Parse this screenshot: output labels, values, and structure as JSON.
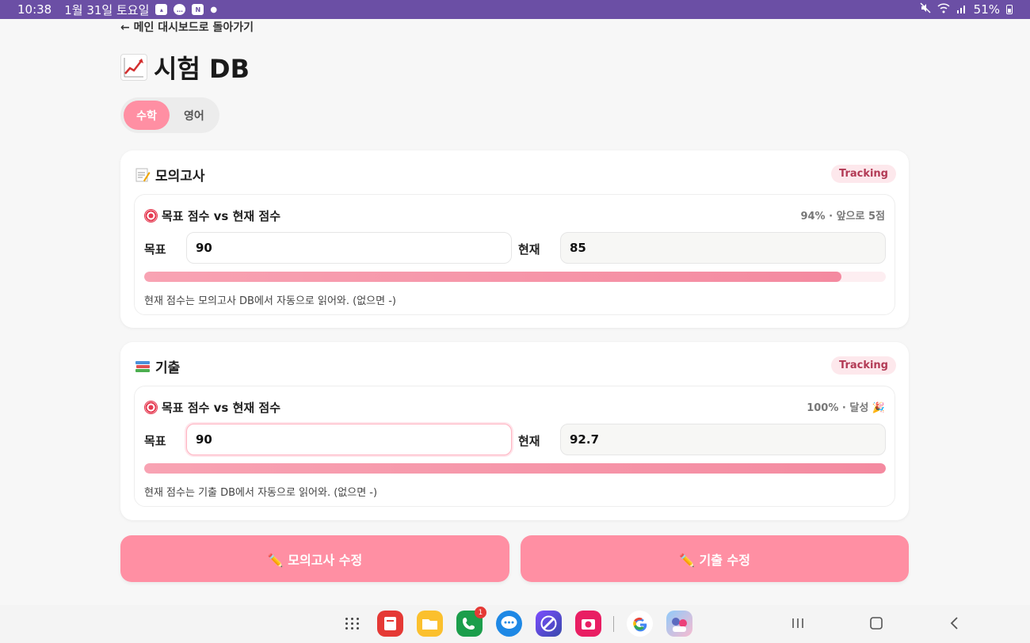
{
  "status": {
    "time": "10:38",
    "date": "1월 31일 토요일",
    "battery": "51%",
    "notif_icons": [
      "gallery-icon",
      "talk-icon",
      "naver-icon"
    ]
  },
  "nav": {
    "back_label": "← 메인 대시보드로 돌아가기"
  },
  "page": {
    "title": "시험 DB",
    "title_icon": "chart-increasing-icon"
  },
  "tabs": [
    {
      "label": "수학",
      "active": true
    },
    {
      "label": "영어",
      "active": false
    }
  ],
  "cards": [
    {
      "title": "모의고사",
      "icon": "memo-icon",
      "badge": "Tracking",
      "section_title": "목표 점수 vs 현재 점수",
      "progress_text": "94% · 앞으로 5점",
      "target_label": "목표",
      "target_value": "90",
      "current_label": "현재",
      "current_value": "85",
      "progress": 0.94,
      "note": "현재 점수는 모의고사 DB에서 자동으로 읽어와. (없으면 -)"
    },
    {
      "title": "기출",
      "icon": "books-icon",
      "badge": "Tracking",
      "section_title": "목표 점수 vs 현재 점수",
      "progress_text": "100% · 달성 🎉",
      "target_label": "목표",
      "target_value": "90",
      "current_label": "현재",
      "current_value": "92.7",
      "progress": 1.0,
      "note": "현재 점수는 기출 DB에서 자동으로 읽어와. (없으면 -)"
    }
  ],
  "actions": {
    "edit_mock": "✏️ 모의고사 수정",
    "edit_past": "✏️ 기출 수정"
  },
  "colors": {
    "accent": "#ff8fa3",
    "status_bar": "#6b4fa5",
    "badge_bg": "#fde8ec",
    "badge_text": "#b23a55"
  },
  "navbar": {
    "apps": [
      "apps-grid-icon",
      "notes-app-icon",
      "files-app-icon",
      "phone-app-icon",
      "messages-app-icon",
      "internet-app-icon",
      "camera-app-icon",
      "google-app-icon",
      "game-app-icon"
    ],
    "phone_badge": "1"
  }
}
